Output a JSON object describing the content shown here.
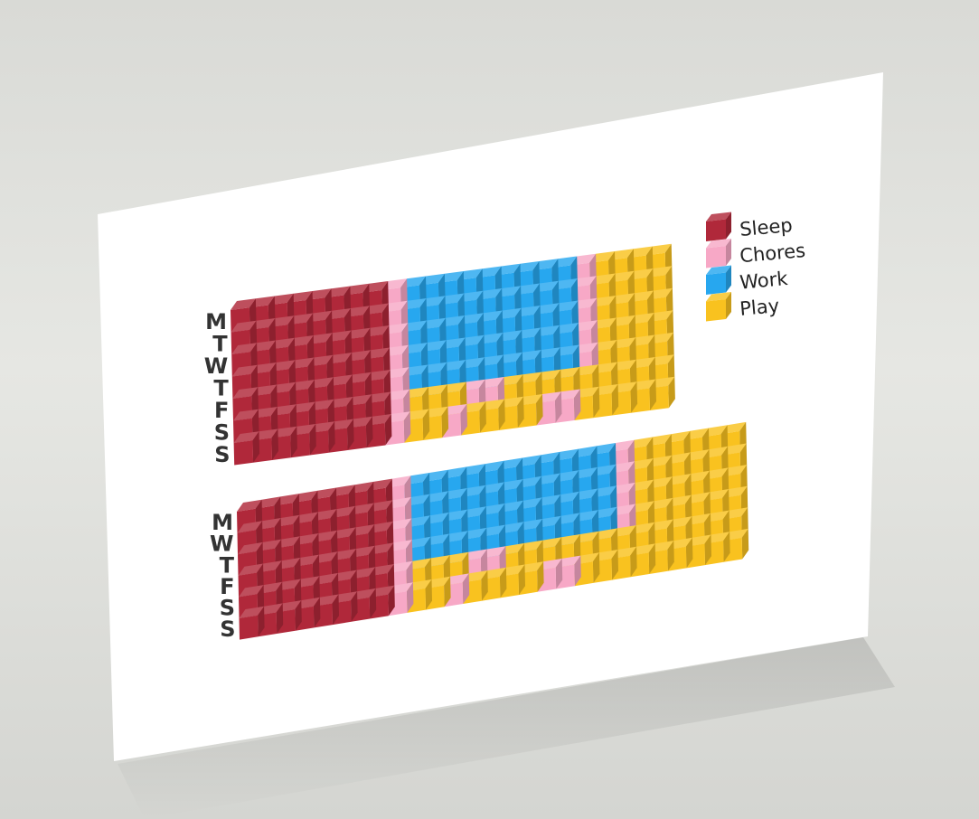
{
  "chart_data": {
    "type": "heatmap",
    "subtype": "isometric-waffle",
    "legend": {
      "placement": "top-right",
      "items": [
        {
          "key": "S",
          "label": "Sleep",
          "color": "#b0283a"
        },
        {
          "key": "C",
          "label": "Chores",
          "color": "#f7a8c6"
        },
        {
          "key": "W",
          "label": "Work",
          "color": "#27a7ef"
        },
        {
          "key": "P",
          "label": "Play",
          "color": "#f9c21f"
        }
      ]
    },
    "charts": [
      {
        "row_labels": [
          "M",
          "T",
          "W",
          "T",
          "F",
          "S",
          "S"
        ],
        "rows": [
          "SSSSSSSSCWWWWWWWWWCPPPP",
          "SSSSSSSSCWWWWWWWWWCPPPP",
          "SSSSSSSSCWWWWWWWWWCPPPP",
          "SSSSSSSSCWWWWWWWWWCPPPP",
          "SSSSSSSSCWWWWWWWWWCPPPP",
          "SSSSSSSSCPPPCCPPPPPPPPP",
          "SSSSSSSSCPPCPPPPCCPPPPP"
        ]
      },
      {
        "row_labels": [
          "M",
          "W",
          "T",
          "F",
          "S",
          "S"
        ],
        "rows": [
          "SSSSSSSSCWWWWWWWWWWWCPPPPPP",
          "SSSSSSSSCWWWWWWWWWWWCPPPPPP",
          "SSSSSSSSCWWWWWWWWWWWCPPPPPP",
          "SSSSSSSSCWWWWWWWWWWWCPPPPPP",
          "SSSSSSSSCPPPCCPPPPPPPPPPPPP",
          "SSSSSSSSCPPCPPPPCCPPPPPPPPP"
        ]
      }
    ]
  }
}
